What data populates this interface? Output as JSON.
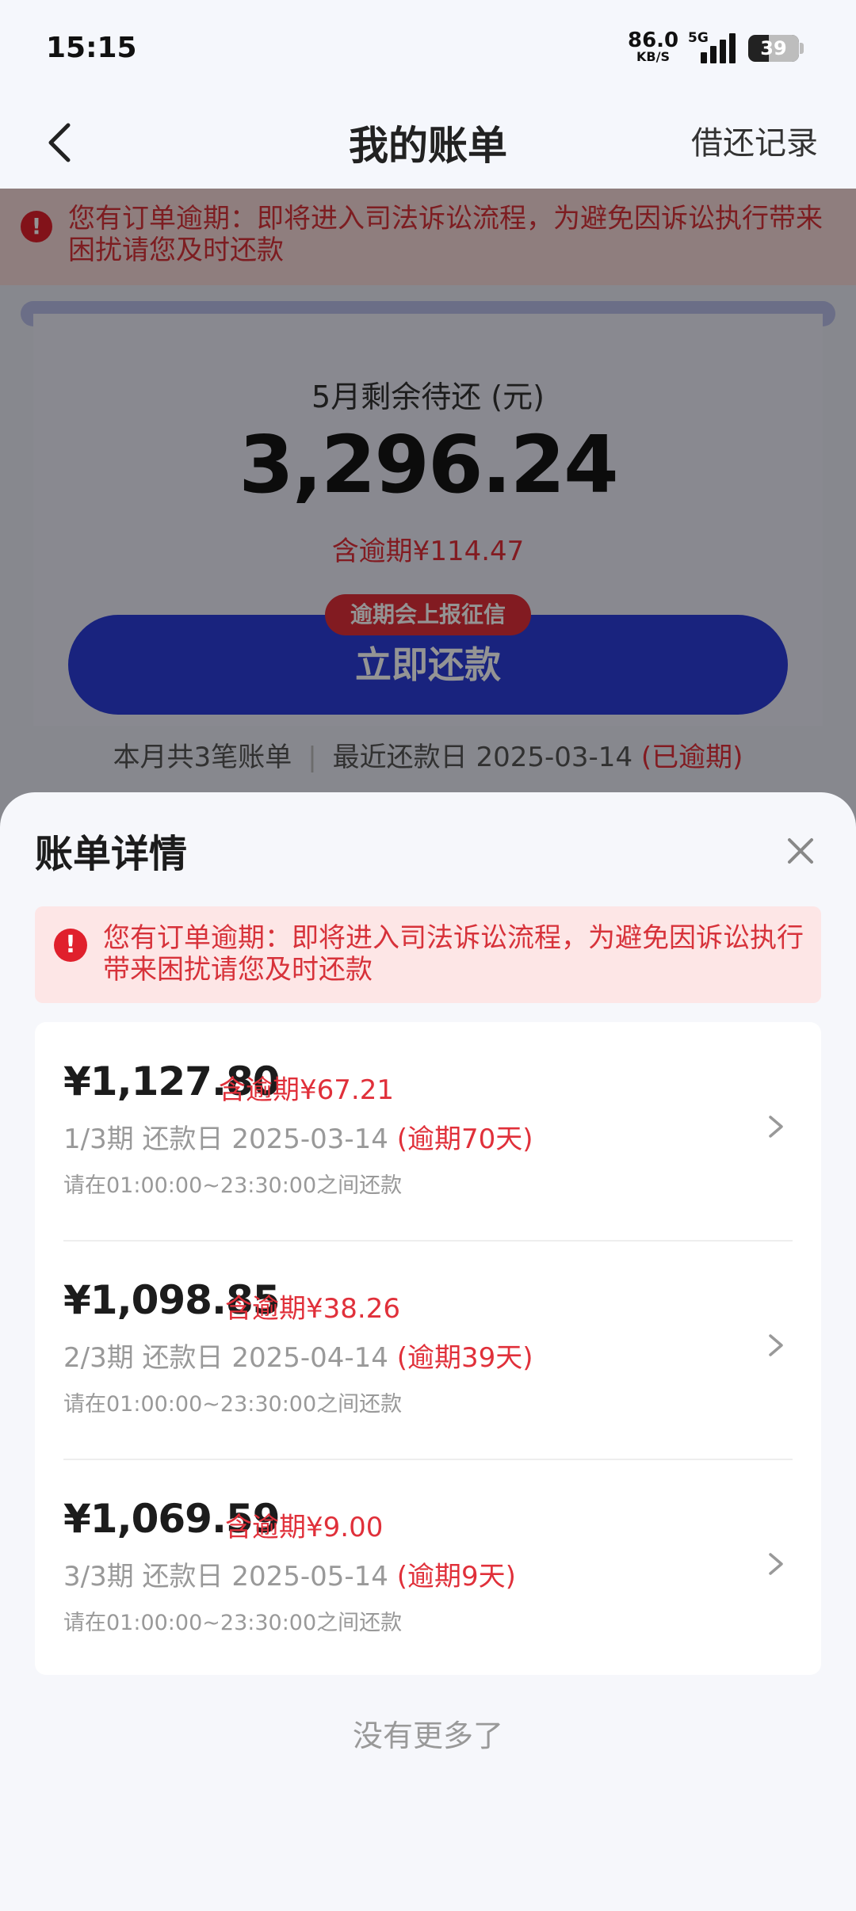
{
  "status_bar": {
    "time": "15:15",
    "net_speed_value": "86.0",
    "net_speed_unit": "KB/S",
    "network": "5G",
    "battery": "39"
  },
  "nav": {
    "title": "我的账单",
    "right_link": "借还记录"
  },
  "background_page": {
    "warning": "您有订单逾期：即将进入司法诉讼流程，为避免因诉讼执行带来困扰请您及时还款",
    "remain_label": "5月剩余待还 (元)",
    "remain_amount": "3,296.24",
    "overdue_included": "含逾期¥114.47",
    "credit_badge": "逾期会上报征信",
    "pay_button": "立即还款",
    "month_count": "本月共3笔账单",
    "separator": "|",
    "recent_due": "最近还款日 2025-03-14",
    "recent_status": "(已逾期)"
  },
  "sheet": {
    "title": "账单详情",
    "warning": "您有订单逾期：即将进入司法诉讼流程，为避免因诉讼执行带来困扰请您及时还款",
    "bills": [
      {
        "amount": "¥1,127.80",
        "overdue_amount": "含逾期¥67.21",
        "term": "1/3期",
        "due_label": "还款日",
        "due_date": "2025-03-14",
        "overdue_days": "(逾期70天)",
        "time_window": "请在01:00:00~23:30:00之间还款"
      },
      {
        "amount": "¥1,098.85",
        "overdue_amount": "含逾期¥38.26",
        "term": "2/3期",
        "due_label": "还款日",
        "due_date": "2025-04-14",
        "overdue_days": "(逾期39天)",
        "time_window": "请在01:00:00~23:30:00之间还款"
      },
      {
        "amount": "¥1,069.59",
        "overdue_amount": "含逾期¥9.00",
        "term": "3/3期",
        "due_label": "还款日",
        "due_date": "2025-05-14",
        "overdue_days": "(逾期9天)",
        "time_window": "请在01:00:00~23:30:00之间还款"
      }
    ],
    "footer": "没有更多了"
  },
  "colors": {
    "accent_blue": "#2b3dd9",
    "overdue_red": "#e0303a",
    "warning_bg": "#fde6e6"
  },
  "icons": [
    "back-icon",
    "alert-icon",
    "close-icon",
    "chevron-right-icon",
    "signal-icon",
    "battery-icon"
  ]
}
